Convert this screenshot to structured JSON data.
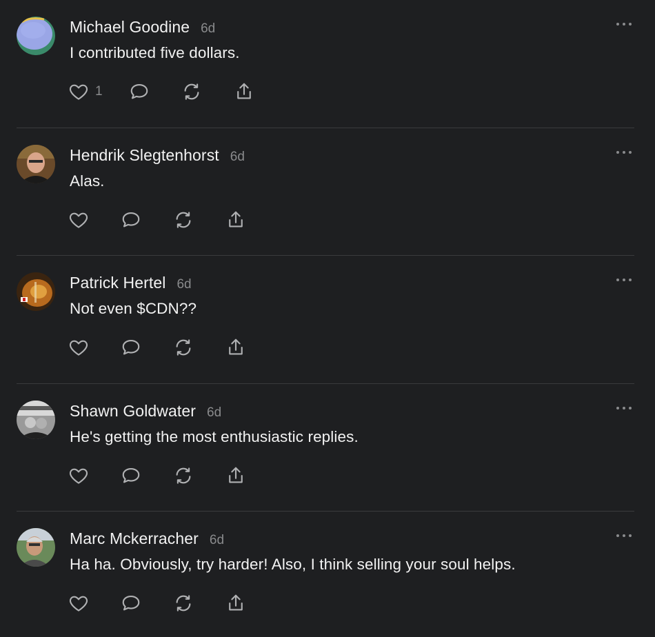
{
  "colors": {
    "background": "#1e1f21",
    "text_primary": "#f2f2f2",
    "text_secondary": "#8a8b8d",
    "icon": "#b0b1b3",
    "divider": "#3a3b3d"
  },
  "posts": [
    {
      "author": "Michael Goodine",
      "time": "6d",
      "text": "I contributed five dollars.",
      "like_count": "1",
      "avatar_icon": "abstract-avatar"
    },
    {
      "author": "Hendrik Slegtenhorst",
      "time": "6d",
      "text": "Alas.",
      "like_count": "",
      "avatar_icon": "photo-avatar"
    },
    {
      "author": "Patrick Hertel",
      "time": "6d",
      "text": "Not even $CDN??",
      "like_count": "",
      "avatar_icon": "guitar-avatar"
    },
    {
      "author": "Shawn Goldwater",
      "time": "6d",
      "text": "He's getting the most enthusiastic replies.",
      "like_count": "",
      "avatar_icon": "photo-avatar"
    },
    {
      "author": "Marc Mckerracher",
      "time": "6d",
      "text": "Ha ha. Obviously, try harder! Also, I think selling your soul helps.",
      "like_count": "",
      "avatar_icon": "photo-avatar"
    }
  ]
}
